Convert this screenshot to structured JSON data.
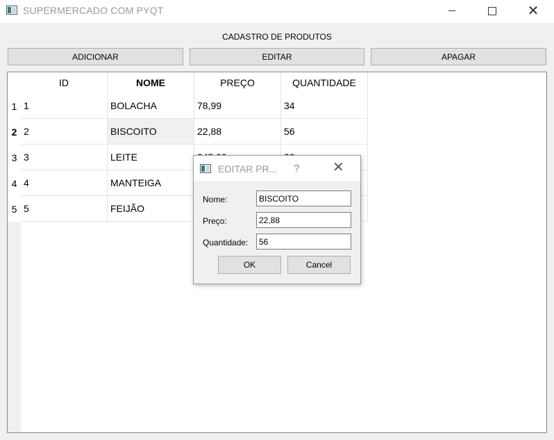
{
  "window": {
    "title": "SUPERMERCADO COM PYQT",
    "icons": {
      "app": "app-window-icon",
      "minimize": "minimize-icon",
      "maximize": "maximize-icon",
      "close": "close-icon"
    }
  },
  "page": {
    "title": "CADASTRO DE PRODUTOS"
  },
  "toolbar": {
    "add_label": "ADICIONAR",
    "edit_label": "EDITAR",
    "delete_label": "APAGAR"
  },
  "table": {
    "columns": [
      "ID",
      "NOME",
      "PREÇO",
      "QUANTIDADE"
    ],
    "row_numbers": [
      "1",
      "2",
      "3",
      "4",
      "5"
    ],
    "rows": [
      [
        "1",
        "BOLACHA",
        "78,99",
        "34"
      ],
      [
        "2",
        "BISCOITO",
        "22,88",
        "56"
      ],
      [
        "3",
        "LEITE",
        "245,99",
        "23"
      ],
      [
        "4",
        "MANTEIGA",
        "",
        ""
      ],
      [
        "5",
        "FEIJÃO",
        "",
        ""
      ]
    ],
    "selected_row": "2"
  },
  "dialog": {
    "title": "EDITAR PR...",
    "help": "?",
    "close": "✕",
    "name_label": "Nome:",
    "name_value": "BISCOITO",
    "price_label": "Preço:",
    "price_value": "22,88",
    "qty_label": "Quantidade:",
    "qty_value": "56",
    "ok_label": "OK",
    "cancel_label": "Cancel"
  }
}
